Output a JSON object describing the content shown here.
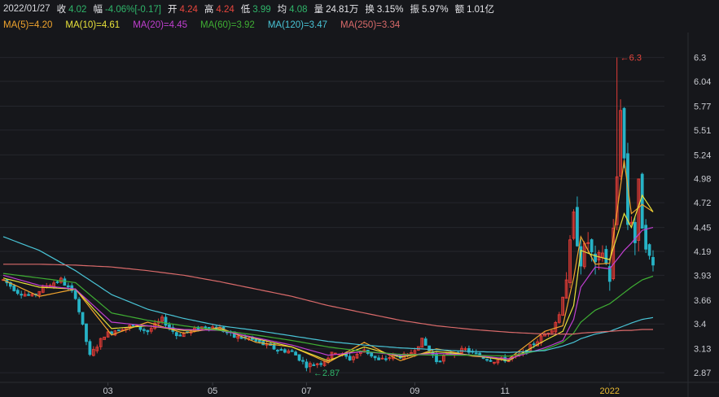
{
  "colors": {
    "background": "#16171b",
    "up": "#e03c36",
    "down": "#27b3c6",
    "up_text": "#e8463d",
    "down_text": "#2fb56a",
    "grid": "#25272d",
    "axis_text": "#c9cbd1",
    "year_text": "#e8b931"
  },
  "quote": {
    "date": "2022/01/27",
    "fields": [
      {
        "label": "收",
        "value": "4.02",
        "tone": "down"
      },
      {
        "label": "幅",
        "value": "-4.06%[-0.17]",
        "tone": "down"
      },
      {
        "label": "开",
        "value": "4.24",
        "tone": "up"
      },
      {
        "label": "高",
        "value": "4.24",
        "tone": "up"
      },
      {
        "label": "低",
        "value": "3.99",
        "tone": "down"
      },
      {
        "label": "均",
        "value": "4.08",
        "tone": "down"
      },
      {
        "label": "量",
        "value": "24.81万",
        "tone": "neutral"
      },
      {
        "label": "换",
        "value": "3.15%",
        "tone": "neutral"
      },
      {
        "label": "振",
        "value": "5.97%",
        "tone": "neutral"
      },
      {
        "label": "额",
        "value": "1.01亿",
        "tone": "neutral"
      }
    ]
  },
  "chart_data": {
    "type": "candlestick",
    "y_ticks": [
      "6.3",
      "6.04",
      "5.77",
      "5.51",
      "5.24",
      "4.98",
      "4.72",
      "4.45",
      "4.19",
      "3.93",
      "3.66",
      "3.4",
      "3.13",
      "2.87"
    ],
    "y_range": [
      2.8,
      6.5
    ],
    "x_ticks": [
      {
        "label": "03",
        "index": 29,
        "year": false
      },
      {
        "label": "05",
        "index": 58,
        "year": false
      },
      {
        "label": "07",
        "index": 84,
        "year": false
      },
      {
        "label": "09",
        "index": 114,
        "year": false
      },
      {
        "label": "11",
        "index": 139,
        "year": false
      },
      {
        "label": "2022",
        "index": 168,
        "year": true
      }
    ],
    "annotations": [
      {
        "text": "6.3",
        "arrow": "←",
        "index": 170,
        "value": 6.3,
        "color": "#e8463d"
      },
      {
        "text": "2.87",
        "arrow": "←",
        "index": 85,
        "value": 2.87,
        "color": "#2fb56a"
      }
    ],
    "ma_series": [
      {
        "name": "MA(5)",
        "last": "4.20",
        "color": "#f0a42d",
        "x": [
          0,
          10,
          20,
          30,
          40,
          50,
          60,
          70,
          80,
          90,
          100,
          110,
          120,
          130,
          140,
          150,
          155,
          158,
          160,
          164,
          168,
          172,
          174,
          177,
          180
        ],
        "y": [
          3.88,
          3.7,
          3.78,
          3.28,
          3.42,
          3.3,
          3.36,
          3.2,
          3.15,
          2.98,
          3.2,
          3.0,
          3.13,
          3.05,
          3.02,
          3.32,
          3.38,
          3.9,
          4.35,
          4.05,
          4.06,
          5.18,
          4.6,
          4.7,
          4.62
        ]
      },
      {
        "name": "MA(10)",
        "last": "4.61",
        "color": "#e8e23a",
        "x": [
          0,
          10,
          20,
          30,
          40,
          50,
          60,
          70,
          80,
          90,
          100,
          110,
          120,
          130,
          140,
          150,
          155,
          158,
          160,
          164,
          168,
          172,
          174,
          177,
          180
        ],
        "y": [
          3.9,
          3.8,
          3.78,
          3.35,
          3.38,
          3.33,
          3.34,
          3.24,
          3.15,
          3.0,
          3.15,
          3.04,
          3.1,
          3.06,
          3.0,
          3.22,
          3.32,
          3.6,
          4.2,
          4.14,
          4.1,
          4.6,
          4.45,
          4.8,
          4.62
        ]
      },
      {
        "name": "MA(20)",
        "last": "4.45",
        "color": "#c13fd1",
        "x": [
          0,
          10,
          20,
          30,
          40,
          50,
          60,
          70,
          80,
          90,
          100,
          110,
          120,
          130,
          140,
          150,
          155,
          158,
          160,
          164,
          168,
          172,
          174,
          177,
          180
        ],
        "y": [
          3.93,
          3.82,
          3.78,
          3.42,
          3.38,
          3.34,
          3.33,
          3.25,
          3.17,
          3.06,
          3.1,
          3.06,
          3.08,
          3.06,
          3.02,
          3.14,
          3.22,
          3.45,
          3.8,
          4.02,
          4.0,
          4.2,
          4.28,
          4.42,
          4.45
        ]
      },
      {
        "name": "MA(60)",
        "last": "3.92",
        "color": "#3fae33",
        "x": [
          0,
          10,
          20,
          30,
          40,
          50,
          60,
          70,
          80,
          90,
          100,
          110,
          120,
          130,
          140,
          150,
          155,
          158,
          160,
          164,
          168,
          172,
          174,
          177,
          180
        ],
        "y": [
          3.95,
          3.9,
          3.85,
          3.52,
          3.44,
          3.38,
          3.33,
          3.28,
          3.22,
          3.15,
          3.1,
          3.07,
          3.06,
          3.06,
          3.05,
          3.12,
          3.2,
          3.3,
          3.42,
          3.55,
          3.62,
          3.74,
          3.8,
          3.88,
          3.92
        ]
      },
      {
        "name": "MA(120)",
        "last": "3.47",
        "color": "#49c4d6",
        "x": [
          0,
          10,
          20,
          30,
          40,
          50,
          60,
          70,
          80,
          90,
          100,
          110,
          120,
          130,
          140,
          150,
          155,
          158,
          160,
          164,
          168,
          172,
          174,
          177,
          180
        ],
        "y": [
          4.35,
          4.2,
          3.98,
          3.72,
          3.56,
          3.46,
          3.38,
          3.33,
          3.27,
          3.21,
          3.17,
          3.14,
          3.12,
          3.1,
          3.09,
          3.11,
          3.16,
          3.2,
          3.24,
          3.29,
          3.32,
          3.38,
          3.41,
          3.45,
          3.47
        ]
      },
      {
        "name": "MA(250)",
        "last": "3.34",
        "color": "#d96a6a",
        "x": [
          0,
          10,
          20,
          30,
          40,
          50,
          60,
          70,
          80,
          90,
          100,
          110,
          120,
          130,
          140,
          150,
          155,
          158,
          160,
          164,
          168,
          172,
          174,
          177,
          180
        ],
        "y": [
          4.05,
          4.05,
          4.04,
          4.02,
          3.98,
          3.93,
          3.86,
          3.78,
          3.7,
          3.6,
          3.52,
          3.44,
          3.38,
          3.34,
          3.31,
          3.29,
          3.29,
          3.29,
          3.3,
          3.31,
          3.32,
          3.33,
          3.33,
          3.34,
          3.34
        ]
      }
    ],
    "price_path": {
      "x": [
        0,
        4,
        8,
        12,
        16,
        20,
        24,
        28,
        32,
        36,
        40,
        44,
        48,
        52,
        56,
        60,
        64,
        68,
        72,
        76,
        80,
        84,
        88,
        92,
        96,
        100,
        104,
        108,
        112,
        116,
        120,
        124,
        128,
        132,
        136,
        140,
        144,
        148,
        152,
        154,
        156,
        158,
        160,
        162,
        164,
        166,
        168,
        169,
        170,
        171,
        172,
        173,
        174,
        175,
        176,
        177,
        178,
        179,
        180
      ],
      "y": [
        3.88,
        3.75,
        3.7,
        3.82,
        3.88,
        3.7,
        3.05,
        3.28,
        3.35,
        3.38,
        3.32,
        3.45,
        3.28,
        3.32,
        3.38,
        3.35,
        3.26,
        3.24,
        3.18,
        3.12,
        3.1,
        2.95,
        2.98,
        3.1,
        3.02,
        3.12,
        3.0,
        3.05,
        3.05,
        3.22,
        3.0,
        3.08,
        3.12,
        3.05,
        3.0,
        3.02,
        3.08,
        3.22,
        3.35,
        3.5,
        3.92,
        4.55,
        4.1,
        4.3,
        4.0,
        4.2,
        3.9,
        4.4,
        5.0,
        5.78,
        5.2,
        4.5,
        4.55,
        4.3,
        4.9,
        4.5,
        4.3,
        4.1,
        4.02
      ]
    }
  }
}
